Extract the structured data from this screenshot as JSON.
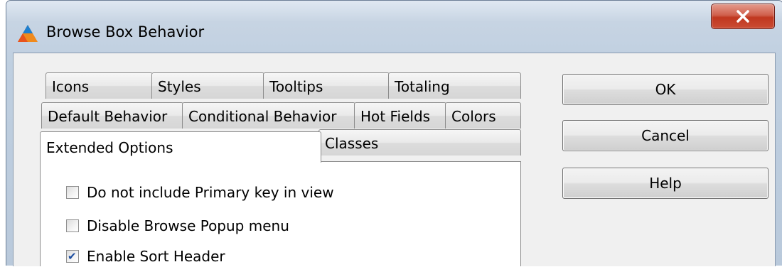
{
  "window": {
    "title": "Browse Box Behavior"
  },
  "tabs": {
    "icons": "Icons",
    "styles": "Styles",
    "tooltips": "Tooltips",
    "totaling": "Totaling",
    "default_behavior": "Default Behavior",
    "conditional_behavior": "Conditional Behavior",
    "hot_fields": "Hot Fields",
    "colors": "Colors",
    "extended_options": "Extended Options",
    "classes": "Classes",
    "active": "Extended Options"
  },
  "options": [
    {
      "label": "Do not include Primary key in view",
      "checked": false
    },
    {
      "label": "Disable Browse Popup menu",
      "checked": false
    },
    {
      "label": "Enable Sort Header",
      "checked": true
    }
  ],
  "buttons": {
    "ok": "OK",
    "cancel": "Cancel",
    "help": "Help"
  },
  "colors": {
    "close_button": "#c7432b",
    "client_bg": "#f0f0f0",
    "checkmark": "#1c4da0"
  }
}
